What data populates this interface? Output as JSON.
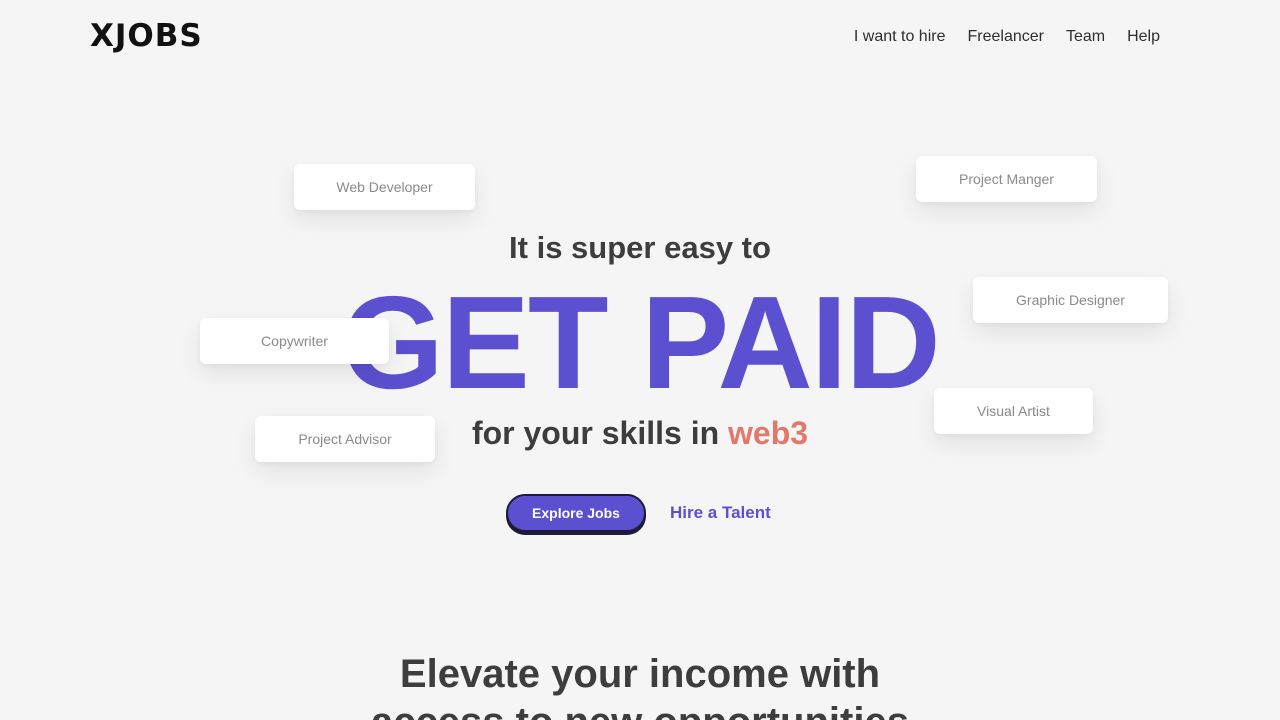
{
  "header": {
    "logo_text": "XJOBS",
    "nav": [
      {
        "label": "I want to hire"
      },
      {
        "label": "Freelancer"
      },
      {
        "label": "Team"
      },
      {
        "label": "Help"
      }
    ]
  },
  "tags": {
    "web_developer": "Web Developer",
    "project_manager": "Project Manger",
    "graphic_designer": "Graphic Designer",
    "copywriter": "Copywriter",
    "visual_artist": "Visual Artist",
    "project_advisor": "Project Advisor"
  },
  "hero": {
    "line1": "It is super easy to",
    "title": "GET PAID",
    "line3_prefix": "for your skills in ",
    "line3_accent": "web3"
  },
  "cta": {
    "primary_label": "Explore Jobs",
    "secondary_label": "Hire a Talent"
  },
  "section2": {
    "title": "Elevate your income with",
    "title_line2": "access to new opportunities"
  },
  "colors": {
    "accent_purple": "#5b50d0",
    "accent_coral": "#e2786a",
    "text_dark": "#3d3d3d",
    "background": "#f5f5f5"
  }
}
